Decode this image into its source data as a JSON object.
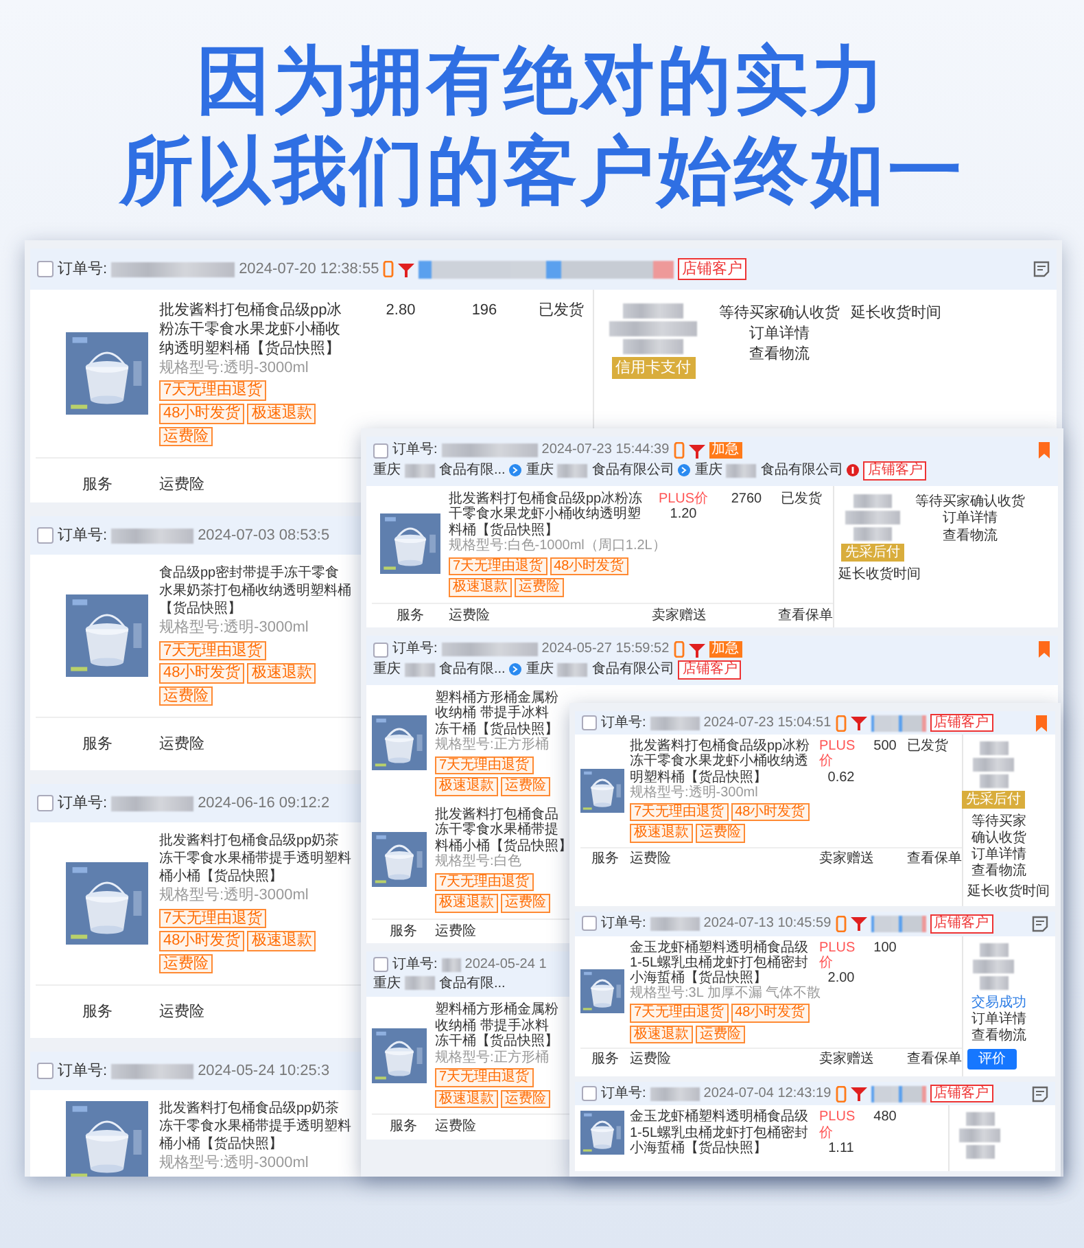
{
  "headline": [
    "因为拥有绝对的实力",
    "所以我们的客户始终如一"
  ],
  "panels": [
    {
      "orders": [
        {
          "kind": "full",
          "checked": false,
          "label": "订单号:",
          "date": "2024-07-20 12:38:55",
          "shop_tag": "店铺客户",
          "products": [
            {
              "title": "批发酱料打包桶食品级pp冰粉冻干零食水果龙虾小桶收纳透明塑料桶【货品快照】",
              "spec": "规格型号:透明-3000ml",
              "tags": [
                "7天无理由退货",
                "48小时发货",
                "极速退款",
                "运费险"
              ],
              "price": "2.80",
              "qty": "196",
              "status": "已发货"
            }
          ],
          "buyer_badge": "信用卡支付",
          "actions": [
            {
              "text": "等待买家确认收货",
              "kind": "status"
            },
            {
              "text": "订单详情",
              "kind": "link"
            },
            {
              "text": "查看物流",
              "kind": "link"
            }
          ],
          "extra": {
            "text": "延长收货时间",
            "kind": "link"
          },
          "footer": [
            "服务",
            "运费险"
          ]
        },
        {
          "kind": "partial",
          "checked": false,
          "label": "订单号:",
          "date": "2024-07-03 08:53:5",
          "products": [
            {
              "title_lines": [
                "食品级pp密封带提手冻干零食",
                "水果奶茶打包桶收纳透明塑料桶",
                "【货品快照】"
              ],
              "spec": "规格型号:透明-3000ml",
              "tags": [
                "7天无理由退货",
                "48小时发货",
                "极速退款",
                "运费险"
              ]
            }
          ],
          "footer": [
            "服务",
            "运费险"
          ]
        },
        {
          "kind": "partial",
          "checked": false,
          "label": "订单号:",
          "date": "2024-06-16 09:12:2",
          "products": [
            {
              "title_lines": [
                "批发酱料打包桶食品级pp奶茶",
                "冻干零食水果桶带提手透明塑料",
                "桶小桶【货品快照】"
              ],
              "spec": "规格型号:透明-3000ml",
              "tags": [
                "7天无理由退货",
                "48小时发货",
                "极速退款",
                "运费险"
              ]
            }
          ],
          "footer": [
            "服务",
            "运费险"
          ]
        },
        {
          "kind": "partial",
          "checked": false,
          "label": "订单号:",
          "date": "2024-05-24 10:25:3",
          "products": [
            {
              "title_lines": [
                "批发酱料打包桶食品级pp奶茶",
                "冻干零食水果桶带提手透明塑料",
                "桶小桶【货品快照】"
              ],
              "spec": "规格型号:透明-3000ml"
            }
          ]
        }
      ]
    },
    {
      "orders": [
        {
          "kind": "full",
          "checked": false,
          "label": "订单号:",
          "date": "2024-07-23 15:44:39",
          "rush": "加急",
          "parties": [
            {
              "city": "重庆",
              "company": "食品有限..."
            },
            {
              "city": "重庆",
              "company": "食品有限公司"
            },
            {
              "city": "重庆",
              "company": "食品有限公司"
            }
          ],
          "shop_tag": "店铺客户",
          "products": [
            {
              "title": "批发酱料打包桶食品级pp冰粉冻干零食水果龙虾小桶收纳透明塑料桶【货品快照】",
              "spec": "规格型号:白色-1000ml（周口1.2L）",
              "tags": [
                "7天无理由退货",
                "48小时发货",
                "极速退款",
                "运费险"
              ],
              "price_label": "PLUS价",
              "price": "1.20",
              "qty": "2760",
              "status": "已发货"
            }
          ],
          "buyer_badge": "先采后付",
          "actions": [
            {
              "text": "等待买家确认收货",
              "kind": "status"
            },
            {
              "text": "订单详情",
              "kind": "link"
            },
            {
              "text": "查看物流",
              "kind": "link"
            }
          ],
          "extra": {
            "text": "延长收货时间",
            "kind": "link"
          },
          "footer": [
            "服务",
            "运费险",
            "卖家赠送",
            "查看保单"
          ]
        },
        {
          "kind": "header",
          "checked": false,
          "label": "订单号:",
          "date": "2024-05-27 15:59:52",
          "rush": "加急",
          "parties": [
            {
              "city": "重庆",
              "company": "食品有限..."
            },
            {
              "city": "重庆",
              "company": "食品有限公司"
            }
          ],
          "shop_tag": "店铺客户",
          "products": [
            {
              "title_lines": [
                "塑料桶方形桶金属粉",
                "收纳桶 带提手冰料",
                "冻干桶【货品快照】"
              ],
              "spec": "规格型号:正方形桶",
              "tags": [
                "7天无理由退货",
                "极速退款",
                "运费险"
              ]
            },
            {
              "title_lines": [
                "批发酱料打包桶食品",
                "冻干零食水果桶带提",
                "料桶小桶【货品快照】"
              ],
              "spec": "规格型号:白色",
              "tags": [
                "7天无理由退货",
                "极速退款",
                "运费险"
              ]
            }
          ],
          "footer": [
            "服务",
            "运费险"
          ]
        },
        {
          "kind": "partial",
          "checked": false,
          "label": "订单号:",
          "date": "2024-05-24 1",
          "parties": [
            {
              "city": "重庆",
              "company": "食品有限..."
            }
          ],
          "products": [
            {
              "title_lines": [
                "塑料桶方形桶金属粉",
                "收纳桶 带提手冰料",
                "冻干桶【货品快照】"
              ],
              "spec": "规格型号:正方形桶",
              "tags": [
                "7天无理由退货",
                "极速退款",
                "运费险"
              ]
            }
          ],
          "footer": [
            "服务",
            "运费险"
          ]
        }
      ]
    },
    {
      "orders": [
        {
          "kind": "full",
          "checked": false,
          "label": "订单号:",
          "date": "2024-07-23 15:04:51",
          "shop_tag": "店铺客户",
          "products": [
            {
              "title": "批发酱料打包桶食品级pp冰粉冻干零食水果龙虾小桶收纳透明塑料桶【货品快照】",
              "spec": "规格型号:透明-300ml",
              "tags": [
                "7天无理由退货",
                "48小时发货",
                "极速退款",
                "运费险"
              ],
              "price_label": "PLUS价",
              "price": "0.62",
              "qty": "500",
              "status": "已发货"
            }
          ],
          "buyer_badge": "先采后付",
          "actions": [
            {
              "text": "等待买家确认收货",
              "kind": "status"
            },
            {
              "text": "订单详情",
              "kind": "link"
            },
            {
              "text": "查看物流",
              "kind": "link"
            }
          ],
          "extra": {
            "text": "延长收货时间",
            "kind": "link"
          },
          "footer": [
            "服务",
            "运费险",
            "卖家赠送",
            "查看保单"
          ]
        },
        {
          "kind": "full",
          "checked": false,
          "label": "订单号:",
          "date": "2024-07-13 10:45:59",
          "shop_tag": "店铺客户",
          "products": [
            {
              "title": "金玉龙虾桶塑料透明桶食品级1-5L螺乳虫桶龙虾打包桶密封小海蜇桶【货品快照】",
              "spec": "规格型号:3L 加厚不漏 气体不散",
              "tags": [
                "7天无理由退货",
                "48小时发货",
                "极速退款",
                "运费险"
              ],
              "price_label": "PLUS价",
              "price": "2.00",
              "qty": "100"
            }
          ],
          "actions": [
            {
              "text": "交易成功",
              "kind": "success"
            },
            {
              "text": "订单详情",
              "kind": "link"
            },
            {
              "text": "查看物流",
              "kind": "link"
            }
          ],
          "extra": {
            "text": "评价",
            "kind": "button"
          },
          "footer": [
            "服务",
            "运费险",
            "卖家赠送",
            "查看保单"
          ]
        },
        {
          "kind": "full",
          "checked": false,
          "label": "订单号:",
          "date": "2024-07-04 12:43:19",
          "shop_tag": "店铺客户",
          "products": [
            {
              "title": "金玉龙虾桶塑料透明桶食品级1-5L螺乳虫桶龙虾打包桶密封小海蜇桶【货品快照】",
              "price_label": "PLUS价",
              "price": "1.11",
              "qty": "480"
            }
          ]
        }
      ]
    }
  ]
}
